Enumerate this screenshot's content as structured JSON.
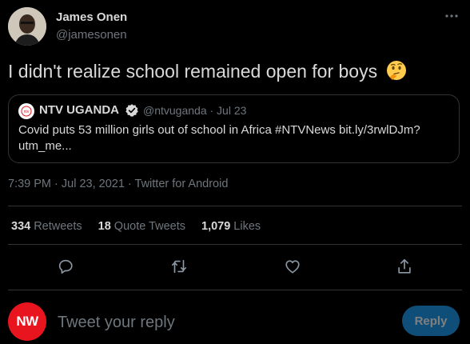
{
  "author": {
    "name": "James Onen",
    "handle": "@jamesonen"
  },
  "tweet": {
    "text": "I didn't realize school remained open for boys",
    "emoji": "thinking-face"
  },
  "quote": {
    "name": "NTV UGANDA",
    "handle_date": "@ntvuganda · Jul 23",
    "text": "Covid puts 53 million girls out of school in Africa #NTVNews bit.ly/3rwlDJm?utm_me..."
  },
  "meta": {
    "time": "7:39 PM · Jul 23, 2021",
    "separator": " · ",
    "source": "Twitter for Android"
  },
  "stats": {
    "retweets_count": "334",
    "retweets_label": "Retweets",
    "quotes_count": "18",
    "quotes_label": "Quote Tweets",
    "likes_count": "1,079",
    "likes_label": "Likes"
  },
  "reply": {
    "avatar_text": "NW",
    "placeholder": "Tweet your reply",
    "button_label": "Reply"
  },
  "colors": {
    "background": "#000000",
    "text": "#d9d9d9",
    "muted": "#6e767d",
    "border": "#2f3336",
    "reply_button": "#0f4e78",
    "reply_avatar": "#e8141e",
    "verified": "#d9d9d9"
  }
}
